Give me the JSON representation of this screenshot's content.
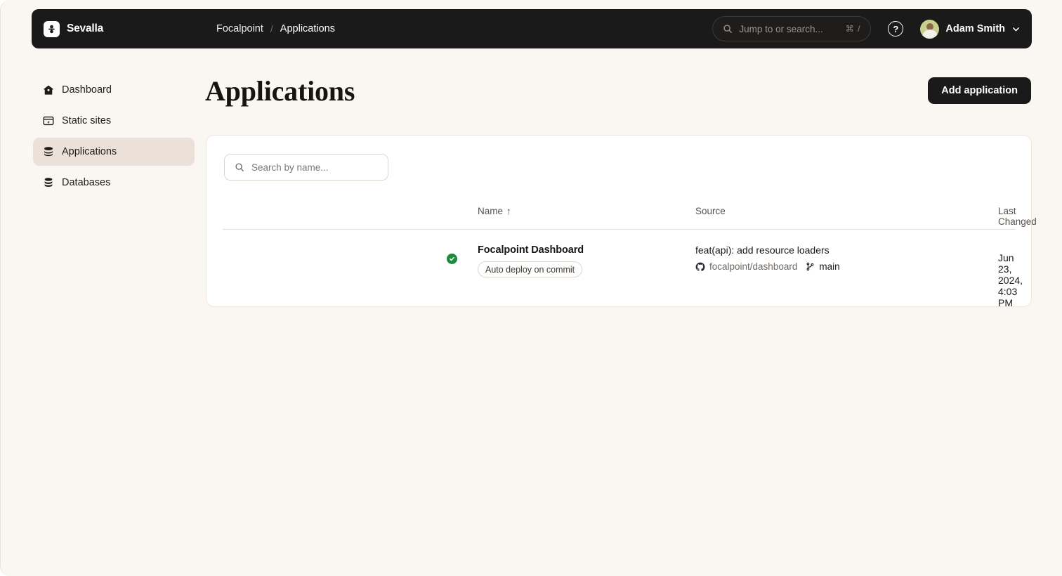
{
  "topbar": {
    "brand_name": "Sevalla",
    "brand_icon": "sevalla-logo-icon",
    "breadcrumbs": [
      {
        "label": "Focalpoint"
      },
      {
        "label": "Applications"
      }
    ],
    "breadcrumb_separator": "/",
    "search": {
      "placeholder": "Jump to or search...",
      "shortcut": "⌘ /",
      "icon": "search-icon"
    },
    "help_label": "?",
    "user": {
      "name": "Adam Smith",
      "avatar_icon": "user-avatar",
      "chevron_icon": "chevron-down-icon"
    }
  },
  "sidebar": {
    "items": [
      {
        "label": "Dashboard",
        "icon": "home-icon",
        "active": false
      },
      {
        "label": "Static sites",
        "icon": "static-site-icon",
        "active": false
      },
      {
        "label": "Applications",
        "icon": "applications-layers-icon",
        "active": true
      },
      {
        "label": "Databases",
        "icon": "database-icon",
        "active": false
      }
    ]
  },
  "main": {
    "title": "Applications",
    "add_button_label": "Add application",
    "card": {
      "search": {
        "placeholder": "Search by name...",
        "value": "",
        "icon": "search-icon"
      },
      "table": {
        "columns": [
          {
            "key": "name",
            "label": "Name",
            "sort_indicator": "↑"
          },
          {
            "key": "source",
            "label": "Source",
            "sort_indicator": ""
          },
          {
            "key": "last_changed",
            "label": "Last Changed",
            "sort_indicator": ""
          }
        ],
        "rows": [
          {
            "status": "success",
            "status_icon": "check-circle-icon",
            "status_color": "#1a8a3c",
            "name": "Focalpoint Dashboard",
            "badge": "Auto deploy on commit",
            "commit_message": "feat(api): add resource loaders",
            "repo": "focalpoint/dashboard",
            "repo_icon": "github-icon",
            "branch": "main",
            "branch_icon": "git-branch-icon",
            "last_changed": "Jun 23, 2024, 4:03 PM"
          }
        ]
      }
    }
  },
  "colors": {
    "page_background": "#faf6f2",
    "topbar_background": "#1a1a1a",
    "card_background": "#ffffff",
    "active_nav_background": "#ece1d8",
    "accent_dark": "#1a1a1a",
    "status_success": "#1a8a3c"
  }
}
